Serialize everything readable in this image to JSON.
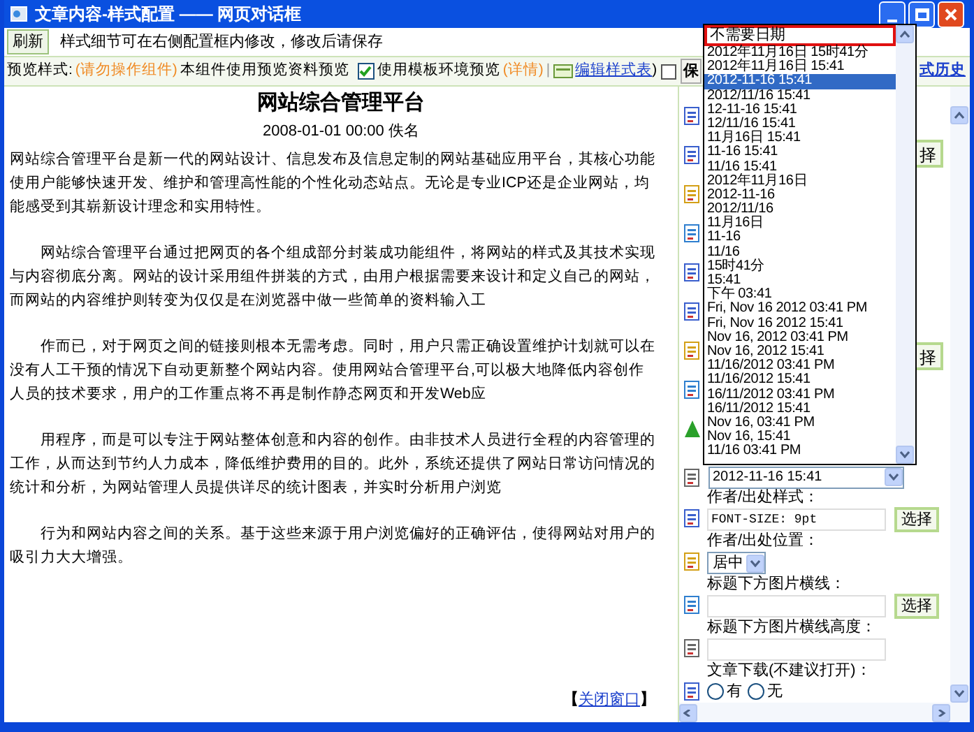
{
  "window": {
    "title": "文章内容-样式配置 —— 网页对话框"
  },
  "toolbar": {
    "refresh_button": "刷新",
    "hint": "样式细节可在右侧配置框内修改，修改后请保存"
  },
  "preview_bar": {
    "label": "预览样式:",
    "warning": "(请勿操作组件)",
    "note": "本组件使用预览资料预览",
    "template_checkbox": {
      "label": "使用模板环境预览",
      "checked": true
    },
    "details_link": "(详情)",
    "separator": "|",
    "edit_link": "编辑样式表",
    "close_paren": ")",
    "extra_checkbox": {
      "checked": false
    },
    "save_button": "保",
    "history_link": "式历史"
  },
  "article": {
    "title": "网站综合管理平台",
    "meta": "2008-01-01 00:00 佚名",
    "paragraphs": [
      {
        "text": "网站综合管理平台是新一代的网站设计、信息发布及信息定制的网站基础应用平台，其核心功能使用户能够快速开发、维护和管理高性能的个性化动态站点。无论是专业ICP还是企业网站，均能感受到其崭新设计理念和实用特性。",
        "indent": false
      },
      {
        "text": "网站综合管理平台通过把网页的各个组成部分封装成功能组件，将网站的样式及其技术实现与内容彻底分离。网站的设计采用组件拼装的方式，由用户根据需要来设计和定义自己的网站，而网站的内容维护则转变为仅仅是在浏览器中做一些简单的资料输入工",
        "indent": true
      },
      {
        "text": "作而已，对于网页之间的链接则根本无需考虑。同时，用户只需正确设置维护计划就可以在没有人工干预的情况下自动更新整个网站内容。使用网站合管理平台,可以极大地降低内容创作人员的技术要求，用户的工作重点将不再是制作静态网页和开发Web应",
        "indent": true
      },
      {
        "text": "用程序，而是可以专注于网站整体创意和内容的创作。由非技术人员进行全程的内容管理的工作，从而达到节约人力成本，降低维护费用的目的。此外，系统还提供了网站日常访问情况的统计和分析，为网站管理人员提供详尽的统计图表，并实时分析用户浏览",
        "indent": true
      },
      {
        "text": "行为和网站内容之间的关系。基于这些来源于用户浏览偏好的正确评估，使得网站对用户的吸引力大大增强。",
        "indent": true
      }
    ],
    "close_open": "【",
    "close_link": "关闭窗口",
    "close_end": "】"
  },
  "config_panel": {
    "partial_buttons": [
      "择",
      "择"
    ],
    "date_select": {
      "value": "2012-11-16 15:41",
      "expanded": true,
      "options": [
        {
          "label": "不需要日期",
          "selected": false,
          "marked": true
        },
        {
          "label": "2012年11月16日 15时41分",
          "selected": false,
          "marked": false
        },
        {
          "label": "2012年11月16日 15:41",
          "selected": false,
          "marked": false
        },
        {
          "label": "2012-11-16 15:41",
          "selected": true,
          "marked": false
        },
        {
          "label": "2012/11/16 15:41",
          "selected": false,
          "marked": false
        },
        {
          "label": "12-11-16 15:41",
          "selected": false,
          "marked": false
        },
        {
          "label": "12/11/16 15:41",
          "selected": false,
          "marked": false
        },
        {
          "label": "11月16日 15:41",
          "selected": false,
          "marked": false
        },
        {
          "label": "11-16 15:41",
          "selected": false,
          "marked": false
        },
        {
          "label": "11/16 15:41",
          "selected": false,
          "marked": false
        },
        {
          "label": "2012年11月16日",
          "selected": false,
          "marked": false
        },
        {
          "label": "2012-11-16",
          "selected": false,
          "marked": false
        },
        {
          "label": "2012/11/16",
          "selected": false,
          "marked": false
        },
        {
          "label": "11月16日",
          "selected": false,
          "marked": false
        },
        {
          "label": "11-16",
          "selected": false,
          "marked": false
        },
        {
          "label": "11/16",
          "selected": false,
          "marked": false
        },
        {
          "label": "15时41分",
          "selected": false,
          "marked": false
        },
        {
          "label": "15:41",
          "selected": false,
          "marked": false
        },
        {
          "label": "下午 03:41",
          "selected": false,
          "marked": false
        },
        {
          "label": "Fri, Nov 16 2012 03:41 PM",
          "selected": false,
          "marked": false
        },
        {
          "label": "Fri, Nov 16 2012 15:41",
          "selected": false,
          "marked": false
        },
        {
          "label": "Nov 16, 2012 03:41 PM",
          "selected": false,
          "marked": false
        },
        {
          "label": "Nov 16, 2012 15:41",
          "selected": false,
          "marked": false
        },
        {
          "label": "11/16/2012 03:41 PM",
          "selected": false,
          "marked": false
        },
        {
          "label": "11/16/2012 15:41",
          "selected": false,
          "marked": false
        },
        {
          "label": "16/11/2012 03:41 PM",
          "selected": false,
          "marked": false
        },
        {
          "label": "16/11/2012 15:41",
          "selected": false,
          "marked": false
        },
        {
          "label": "Nov 16, 03:41 PM",
          "selected": false,
          "marked": false
        },
        {
          "label": "Nov 16, 15:41",
          "selected": false,
          "marked": false
        },
        {
          "label": "11/16 03:41 PM",
          "selected": false,
          "marked": false
        }
      ]
    },
    "fields": [
      {
        "kind": "text",
        "label": "作者/出处样式：",
        "value": "FONT-SIZE: 9pt",
        "button": "选择"
      },
      {
        "kind": "select",
        "label": "作者/出处位置：",
        "value": "居中"
      },
      {
        "kind": "text",
        "label": "标题下方图片横线：",
        "button": "选择"
      },
      {
        "kind": "text",
        "label": "标题下方图片横线高度："
      },
      {
        "kind": "radio",
        "label": "文章下载(不建议打开)：",
        "options": [
          {
            "label": "有",
            "selected": false
          },
          {
            "label": "无",
            "selected": false
          }
        ]
      }
    ]
  }
}
